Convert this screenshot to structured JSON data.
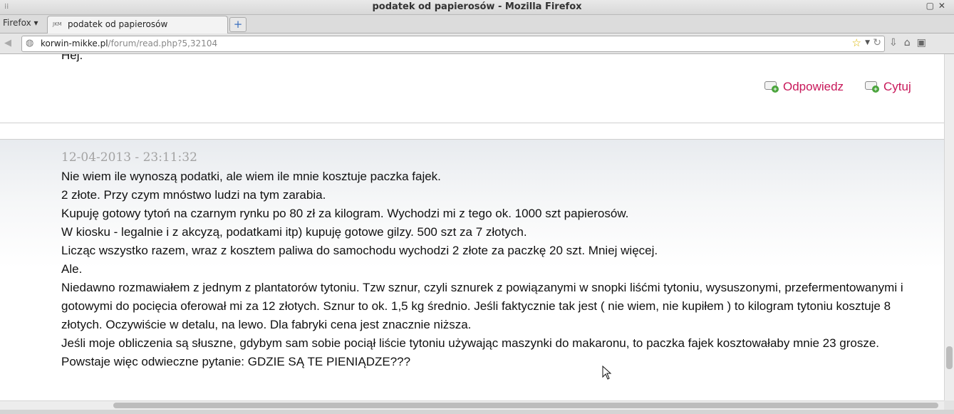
{
  "window": {
    "title": "podatek od papierosów - Mozilla Firefox"
  },
  "tabbar": {
    "firefox_menu": "Firefox ▾",
    "tab": {
      "favicon_text": "JKM",
      "title": "podatek od papierosów"
    },
    "new_tab_label": "+"
  },
  "navbar": {
    "url_host": "korwin-mikke.pl",
    "url_path": "/forum/read.php?5,32104"
  },
  "post_prev": {
    "cutoff_text": "Hej.",
    "reply_label": "Odpowiedz",
    "quote_label": "Cytuj"
  },
  "post": {
    "timestamp": "12-04-2013 - 23:11:32",
    "lines": [
      "Nie wiem ile wynoszą podatki, ale wiem ile mnie kosztuje paczka fajek.",
      "2 złote. Przy czym mnóstwo ludzi na tym zarabia.",
      "Kupuję gotowy tytoń na czarnym rynku po 80 zł za kilogram. Wychodzi mi z tego ok. 1000 szt papierosów.",
      "W kiosku - legalnie i z akcyzą, podatkami itp) kupuję gotowe gilzy. 500 szt za 7 złotych.",
      "Licząc wszystko razem, wraz z kosztem paliwa do samochodu wychodzi 2 złote za paczkę 20 szt. Mniej więcej.",
      "Ale.",
      "Niedawno rozmawiałem z jednym z plantatorów tytoniu. Tzw sznur, czyli sznurek z powiązanymi w snopki liśćmi tytoniu, wysuszonymi, przefermentowanymi i gotowymi do pocięcia oferował mi za 12 złotych. Sznur to ok. 1,5 kg średnio. Jeśli faktycznie tak jest ( nie wiem, nie kupiłem ) to kilogram tytoniu kosztuje 8 złotych. Oczywiście w detalu, na lewo. Dla fabryki cena jest znacznie niższa.",
      "Jeśli moje obliczenia są słuszne, gdybym sam sobie pociął liście tytoniu używając maszynki do makaronu, to paczka fajek kosztowałaby mnie 23 grosze.",
      "Powstaje więc odwieczne pytanie: GDZIE SĄ TE PIENIĄDZE???"
    ]
  },
  "colors": {
    "link": "#c8185a",
    "timestamp": "#a3a3a3",
    "text": "#111111"
  },
  "icons": [
    "back-icon",
    "globe-icon",
    "bookmark-star-icon",
    "dropdown-icon",
    "reload-icon",
    "download-icon",
    "home-icon",
    "addon-icon",
    "reply-icon",
    "quote-icon",
    "mouse-cursor-icon"
  ]
}
